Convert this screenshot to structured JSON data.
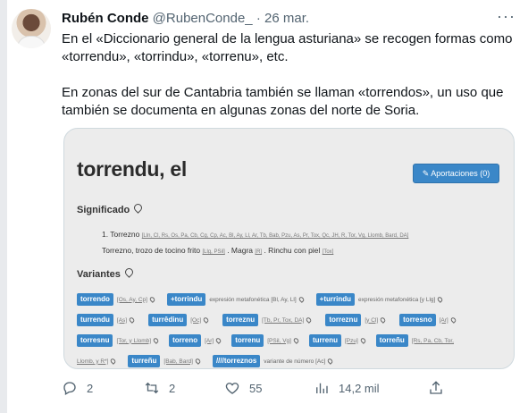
{
  "tweet": {
    "author_name": "Rubén Conde",
    "author_handle": "@RubenConde_",
    "separator": "·",
    "date": "26 mar.",
    "more_icon": "more-dots-icon",
    "paragraph_1": "En el «Diccionario general de la lengua asturiana» se recogen formas como «torrendu», «torrindu», «torrenu», etc.",
    "paragraph_2": "En zonas del sur de Cantabria también se llaman «torrendos», un uso que también se documenta en algunas zonas del norte de Soria."
  },
  "card": {
    "word": "torrendu, el",
    "contrib_button": "✎ Aportaciones (0)",
    "significado_heading": "Significado",
    "def_line1_prefix": "1. Torrezno",
    "def_line1_labels": "[Lln, Cl, Rs, Os, Pa, Cb, Cg, Cp, Ac, Bl, Ay, Ll, Ar, Tb, Bab, Pzu, As, Pr, Tox, Qc, JH, R, Tor, Vg, Llomb, Bard, DA]",
    "def_line2_a": "Torrezno, trozo de tocino frito",
    "def_line2_a_label": "[Llg, PSil]",
    "def_line2_b": ". Magra",
    "def_line2_b_label": "[R]",
    "def_line2_c": ". Rinchu con piel",
    "def_line2_c_label": "[Tox]",
    "variantes_heading": "Variantes",
    "variants": {
      "r1": [
        {
          "tag": "torrendo",
          "note": "[Os, Ay, Cp]",
          "desc": ""
        },
        {
          "tag": "+torrindu",
          "note": "",
          "desc": "expresión metafonética [Bl, Ay, Ll]"
        },
        {
          "tag": "+turrindu",
          "note": "",
          "desc": "expresión metafonética [y Llg]"
        }
      ],
      "r2": [
        {
          "tag": "turrendu",
          "note": "[As]",
          "desc": ""
        },
        {
          "tag": "turrêdinu",
          "note": "[Oc]",
          "desc": ""
        },
        {
          "tag": "torreznu",
          "note": "[Tb, Pr, Tox, DA]",
          "desc": ""
        },
        {
          "tag": "torreznu",
          "note": "[y Cl]",
          "desc": ""
        },
        {
          "tag": "torresno",
          "note": "[Ar]",
          "desc": ""
        }
      ],
      "r3": [
        {
          "tag": "torresnu",
          "note": "[Tor, y Llomb]",
          "desc": ""
        },
        {
          "tag": "torreno",
          "note": "[Ar]",
          "desc": ""
        },
        {
          "tag": "torrenu",
          "note": "[PSil, Vg]",
          "desc": ""
        },
        {
          "tag": "turrenu",
          "note": "[Pzu]",
          "desc": ""
        },
        {
          "tag": "torreñu",
          "note": "[Rs, Pa, Cb, Tor,",
          "desc": ""
        }
      ],
      "r4": [
        {
          "tag": "",
          "note": "Llomb, y R*]",
          "desc": ""
        },
        {
          "tag": "turreñu",
          "note": "[Bab, Bard]",
          "desc": ""
        },
        {
          "tag": "////torreznos",
          "note": "",
          "desc": "variante de número [Ac]"
        }
      ]
    }
  },
  "actions": {
    "reply_count": "2",
    "retweet_count": "2",
    "like_count": "55",
    "views_count": "14,2 mil",
    "reply_icon": "reply-icon",
    "retweet_icon": "retweet-icon",
    "like_icon": "heart-icon",
    "views_icon": "views-icon",
    "share_icon": "share-icon"
  }
}
